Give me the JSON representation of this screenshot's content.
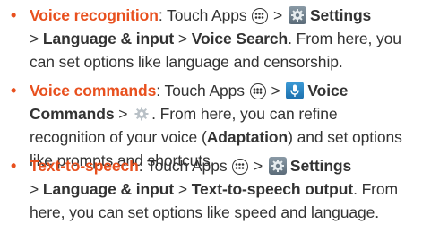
{
  "items": [
    {
      "title": "Voice recognition",
      "lines": [
        {
          "before_icon": ": Touch Apps ",
          "after_apps": " > ",
          "label": "Settings"
        },
        {
          "path": [
            "> ",
            "Language & input",
            " > ",
            "Voice Search",
            ". From here, you"
          ]
        },
        {
          "text": "can set options like language and censorship."
        }
      ]
    },
    {
      "title": "Voice commands",
      "line1": {
        "sep1": ": Touch Apps ",
        "sep2": " > ",
        "label": "Voice"
      },
      "line2": {
        "label": "Commands",
        "sep": " > ",
        "after": ". From here, you can refine"
      },
      "line3": {
        "before": "recognition of your voice (",
        "bold": "Adaptation",
        "after": ") and set options"
      },
      "line4": "like prompts and shortcuts."
    },
    {
      "title": "Text-to-speech",
      "line1": {
        "sep1": ": Touch Apps ",
        "sep2": " > ",
        "label": "Settings"
      },
      "line2": {
        "gt1": "> ",
        "b1": "Language & input",
        "gt2": " > ",
        "b2": "Text-to-speech output",
        "after": ". From"
      },
      "line3": "here, you can set options like speed and language."
    }
  ],
  "icons": {
    "apps": "apps-icon",
    "settings": "settings-icon",
    "voice_commands": "microphone-icon",
    "gear": "gear-icon"
  },
  "colors": {
    "accent": "#e8501e",
    "text": "#333333"
  }
}
